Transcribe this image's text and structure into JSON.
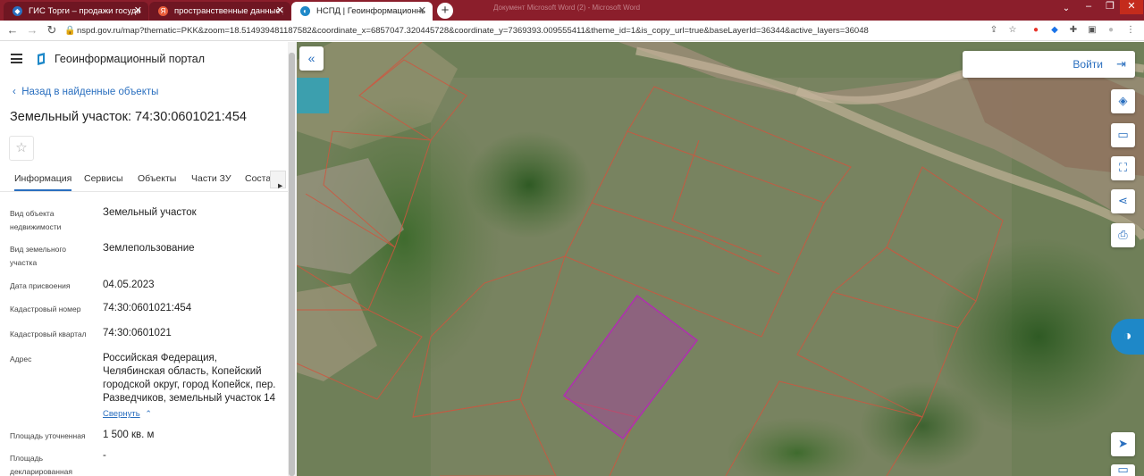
{
  "browser": {
    "tabs": [
      {
        "title": "ГИС Торги – продажи государст",
        "icon": "gis-torgi-favicon"
      },
      {
        "title": "пространственные данные рос",
        "icon": "yandex-favicon"
      },
      {
        "title": "НСПД | Геоинформационный п",
        "icon": "nspd-favicon"
      }
    ],
    "url": "nspd.gov.ru/map?thematic=PKK&zoom=18.514939481187582&coordinate_x=6857047.320445728&coordinate_y=7369393.009555411&theme_id=1&is_copy_url=true&baseLayerId=36344&active_layers=36048",
    "window_title": "Документ Microsoft Word (2) - Microsoft Word"
  },
  "header": {
    "title": "Геоинформационный портал"
  },
  "object": {
    "back_label": "Назад в найденные объекты",
    "title": "Земельный участок: 74:30:0601021:454",
    "tabs": [
      "Информация",
      "Сервисы",
      "Объекты",
      "Части ЗУ",
      "Соста"
    ],
    "fields": [
      {
        "label": "Вид объекта недвижимости",
        "value": "Земельный участок"
      },
      {
        "label": "Вид земельного участка",
        "value": "Землепользование"
      },
      {
        "label": "Дата присвоения",
        "value": "04.05.2023"
      },
      {
        "label": "Кадастровый номер",
        "value": "74:30:0601021:454"
      },
      {
        "label": "Кадастровый квартал",
        "value": "74:30:0601021"
      },
      {
        "label": "Адрес",
        "value": "Российская Федерация, Челябинская область, Копейский городской округ, город Копейск, пер. Разведчиков, земельный участок 14"
      },
      {
        "label": "Площадь уточненная",
        "value": "1 500 кв. м"
      },
      {
        "label": "Площадь декларированная",
        "value": "-"
      }
    ],
    "collapse_label": "Свернуть"
  },
  "map": {
    "login_label": "Войти",
    "accent": "#2a6fbf",
    "parcel_color": "#b02fb0"
  }
}
